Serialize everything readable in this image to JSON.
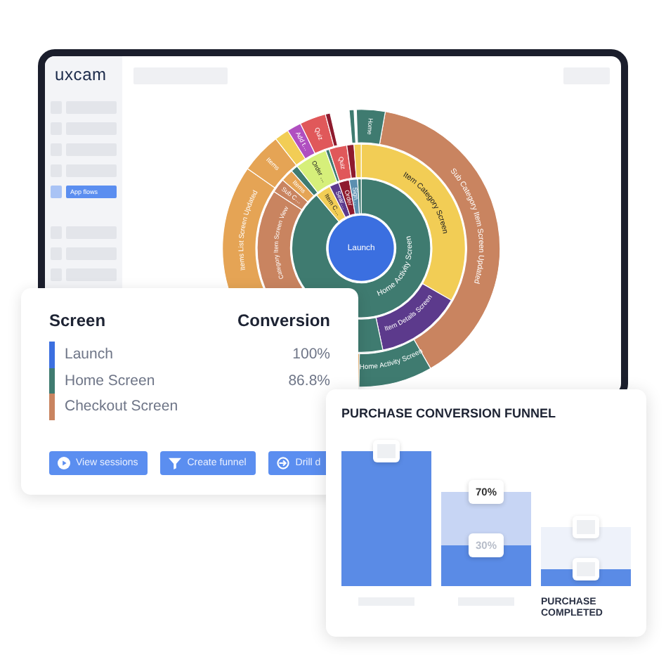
{
  "app": {
    "logo": "uxcam"
  },
  "sidebar": {
    "items": [
      {
        "label": "App flows",
        "selected": true
      }
    ]
  },
  "sunburst": {
    "center_label": "Launch",
    "labels": [
      "Home Activity Screen",
      "Item C…",
      "Sear…",
      "Order",
      "Sign…",
      "Item Category Screen",
      "Item Details Screen",
      "Category Item Screen View",
      "Sub C…",
      "Items",
      "Order …",
      "Quiz",
      "Sub Category Item Screen Updated",
      "Home Activity Screen",
      "Items List Screen Updated",
      "Items",
      "Add t…",
      "Quiz",
      "Home"
    ]
  },
  "conversion_card": {
    "columns": [
      "Screen",
      "Conversion"
    ],
    "rows": [
      {
        "screen": "Launch",
        "conversion": "100%",
        "color": "#3b6fe0"
      },
      {
        "screen": "Home Screen",
        "conversion": "86.8%",
        "color": "#3f7b70"
      },
      {
        "screen": "Checkout Screen",
        "color": "#c98460"
      }
    ],
    "buttons": [
      {
        "label": "View sessions",
        "kind": "play"
      },
      {
        "label": "Create funnel",
        "kind": "funnel"
      },
      {
        "label": "Drill d",
        "kind": "drill"
      }
    ]
  },
  "funnel": {
    "title": "PURCHASE CONVERSION FUNNEL",
    "bars": [
      {
        "segments": [
          {
            "kind": "converted"
          }
        ]
      },
      {
        "segments": [
          {
            "kind": "reach",
            "label": "70%"
          },
          {
            "kind": "converted",
            "label": "30%"
          }
        ]
      },
      {
        "segments": [
          {
            "kind": "drop"
          },
          {
            "kind": "converted"
          }
        ],
        "caption": "PURCHASE COMPLETED"
      }
    ]
  }
}
